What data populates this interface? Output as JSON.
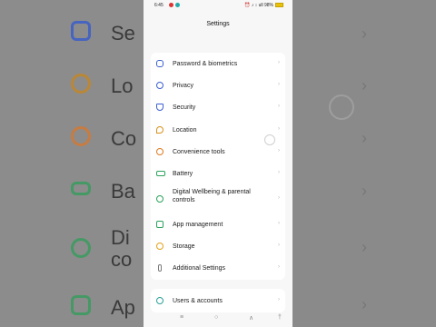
{
  "status_bar": {
    "time": "6:45",
    "right_text": "⏰ ♪ ↕ ull 98%"
  },
  "page_title": "Settings",
  "background": {
    "rows": [
      {
        "label": "Se",
        "icon": "shield-icon",
        "color": "#2f57d1"
      },
      {
        "label": "Lo",
        "icon": "location-icon",
        "color": "#c9861b"
      },
      {
        "label": "Co",
        "icon": "convenience-tools-icon",
        "color": "#d9772a"
      },
      {
        "label": "Ba",
        "icon": "battery-icon",
        "color": "#2e9d58"
      },
      {
        "label": "Di",
        "icon": "digital-wellbeing-icon",
        "color": "#2e9d58",
        "label2": "co"
      },
      {
        "label": "Ap",
        "icon": "app-management-icon",
        "color": "#2e9d58"
      }
    ]
  },
  "settings": {
    "group1": [
      {
        "label": "Password & biometrics",
        "icon": "lock-icon",
        "color": "#3b5fd1"
      },
      {
        "label": "Privacy",
        "icon": "privacy-eye-icon",
        "color": "#3b5fd1"
      },
      {
        "label": "Security",
        "icon": "shield-icon",
        "color": "#3b5fd1"
      },
      {
        "label": "Location",
        "icon": "location-icon",
        "color": "#d7901a"
      },
      {
        "label": "Convenience tools",
        "icon": "convenience-tools-icon",
        "color": "#e07a1e"
      },
      {
        "label": "Battery",
        "icon": "battery-icon",
        "color": "#2aa15a"
      },
      {
        "label": "Digital Wellbeing & parental controls",
        "icon": "digital-wellbeing-icon",
        "color": "#2aa15a"
      },
      {
        "label": "App management",
        "icon": "app-management-icon",
        "color": "#2aa15a"
      },
      {
        "label": "Storage",
        "icon": "storage-icon",
        "color": "#e4a11b"
      },
      {
        "label": "Additional Settings",
        "icon": "additional-settings-icon",
        "color": "#7a7a7a"
      }
    ],
    "group2": [
      {
        "label": "Users & accounts",
        "icon": "users-icon",
        "color": "#2aa19a"
      }
    ]
  },
  "nav": {
    "menu": "≡",
    "home": "○",
    "back": "∧",
    "accessibility": "†"
  }
}
